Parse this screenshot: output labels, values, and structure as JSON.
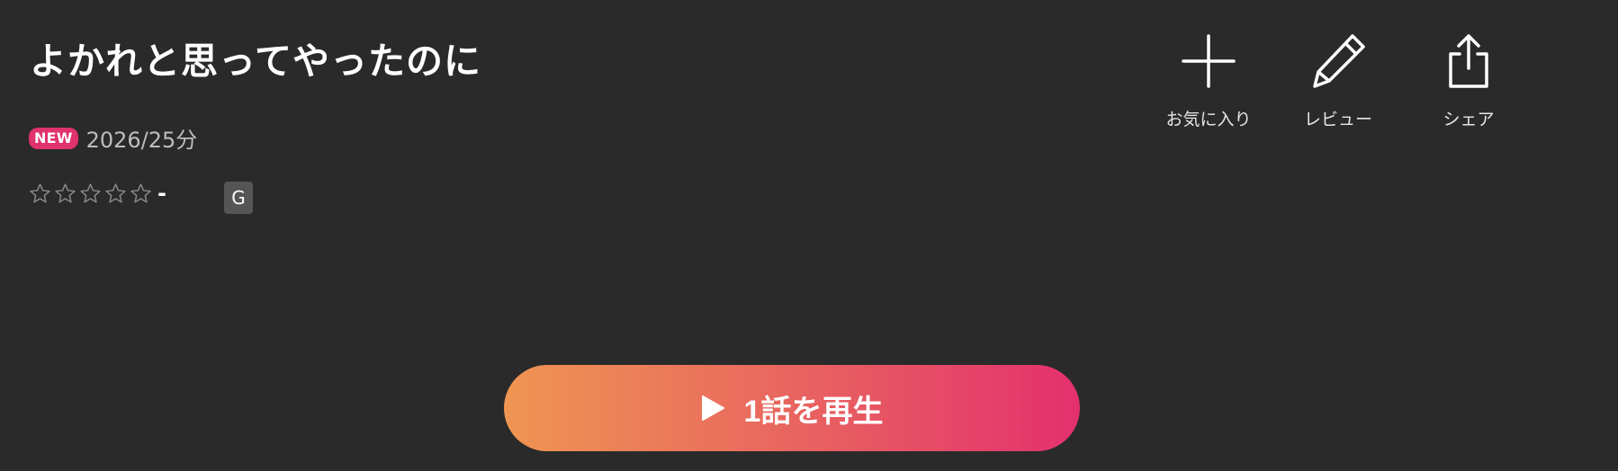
{
  "content": {
    "title": "よかれと思ってやったのに",
    "new_badge": "NEW",
    "year_duration": "2026/25分",
    "rating": {
      "stars_filled": 0,
      "stars_total": 5,
      "value": "-"
    },
    "age_rating": "G"
  },
  "actions": {
    "favorite": {
      "label": "お気に入り",
      "icon": "plus-icon"
    },
    "review": {
      "label": "レビュー",
      "icon": "pencil-icon"
    },
    "share": {
      "label": "シェア",
      "icon": "share-icon"
    }
  },
  "play": {
    "label": "1話を再生",
    "icon": "play-icon"
  },
  "colors": {
    "background": "#2a2a2a",
    "new_badge": "#e0326f",
    "play_gradient_start": "#ef9552",
    "play_gradient_end": "#e3306e",
    "age_badge": "#555555"
  }
}
